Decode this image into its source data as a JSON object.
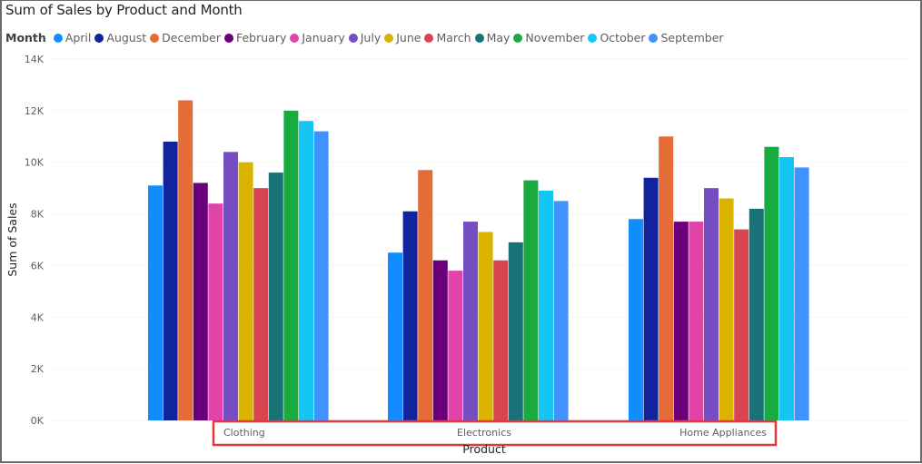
{
  "chart_data": {
    "type": "bar",
    "title": "Sum of Sales by Product and Month",
    "legend_title": "Month",
    "legend_position": "top-left",
    "xlabel": "Product",
    "ylabel": "Sum of Sales",
    "ylim": [
      0,
      14000
    ],
    "yticks": [
      0,
      2000,
      4000,
      6000,
      8000,
      10000,
      12000,
      14000
    ],
    "ytick_labels": [
      "0K",
      "2K",
      "4K",
      "6K",
      "8K",
      "10K",
      "12K",
      "14K"
    ],
    "grid": true,
    "categories": [
      "Clothing",
      "Electronics",
      "Home Appliances"
    ],
    "series": [
      {
        "name": "April",
        "color": "#118DFF",
        "values": [
          9100,
          6500,
          7800
        ]
      },
      {
        "name": "August",
        "color": "#12239E",
        "values": [
          10800,
          8100,
          9400
        ]
      },
      {
        "name": "December",
        "color": "#E66C37",
        "values": [
          12400,
          9700,
          11000
        ]
      },
      {
        "name": "February",
        "color": "#6B007B",
        "values": [
          9200,
          6200,
          7700
        ]
      },
      {
        "name": "January",
        "color": "#E044A7",
        "values": [
          8400,
          5800,
          7700
        ]
      },
      {
        "name": "July",
        "color": "#744EC2",
        "values": [
          10400,
          7700,
          9000
        ]
      },
      {
        "name": "June",
        "color": "#D9B300",
        "values": [
          10000,
          7300,
          8600
        ]
      },
      {
        "name": "March",
        "color": "#D64550",
        "values": [
          9000,
          6200,
          7400
        ]
      },
      {
        "name": "May",
        "color": "#197278",
        "values": [
          9600,
          6900,
          8200
        ]
      },
      {
        "name": "November",
        "color": "#1AAB40",
        "values": [
          12000,
          9300,
          10600
        ]
      },
      {
        "name": "October",
        "color": "#15C6F4",
        "values": [
          11600,
          8900,
          10200
        ]
      },
      {
        "name": "September",
        "color": "#4092FF",
        "values": [
          11200,
          8500,
          9800
        ]
      }
    ],
    "highlight_box_color": "#E0393E"
  }
}
